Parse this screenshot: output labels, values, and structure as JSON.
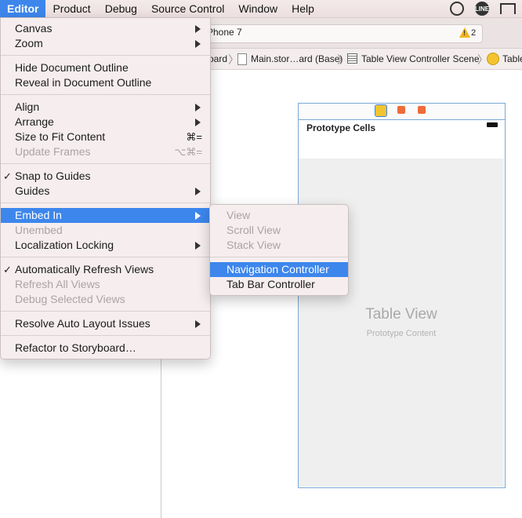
{
  "menubar": {
    "items": [
      "Editor",
      "Product",
      "Debug",
      "Source Control",
      "Window",
      "Help"
    ],
    "tray_line_label": "LINE"
  },
  "toolbar": {
    "scheme_text": "Phone 7",
    "warning_mark": "!",
    "warning_count": "2"
  },
  "jumpbar": {
    "crumbs": [
      "oard",
      "Main.stor…ard (Base)",
      "Table View Controller Scene",
      "Table"
    ]
  },
  "scene": {
    "title": "Prototype Cells",
    "table_title": "Table View",
    "table_subtitle": "Prototype Content"
  },
  "editor_menu": {
    "canvas": "Canvas",
    "zoom": "Zoom",
    "hide_outline": "Hide Document Outline",
    "reveal_outline": "Reveal in Document Outline",
    "align": "Align",
    "arrange": "Arrange",
    "size_to_fit": "Size to Fit Content",
    "size_to_fit_sc": "⌘=",
    "update_frames": "Update Frames",
    "update_frames_sc": "⌥⌘=",
    "snap": "Snap to Guides",
    "guides": "Guides",
    "embed_in": "Embed In",
    "unembed": "Unembed",
    "localization": "Localization Locking",
    "auto_refresh": "Automatically Refresh Views",
    "refresh_all": "Refresh All Views",
    "debug_selected": "Debug Selected Views",
    "resolve": "Resolve Auto Layout Issues",
    "refactor": "Refactor to Storyboard…",
    "check": "✓"
  },
  "embed_menu": {
    "view": "View",
    "scroll_view": "Scroll View",
    "stack_view": "Stack View",
    "navigation_controller": "Navigation Controller",
    "tab_bar_controller": "Tab Bar Controller"
  },
  "colors": {
    "highlight": "#3d86ec",
    "warning": "#f1b51c"
  }
}
